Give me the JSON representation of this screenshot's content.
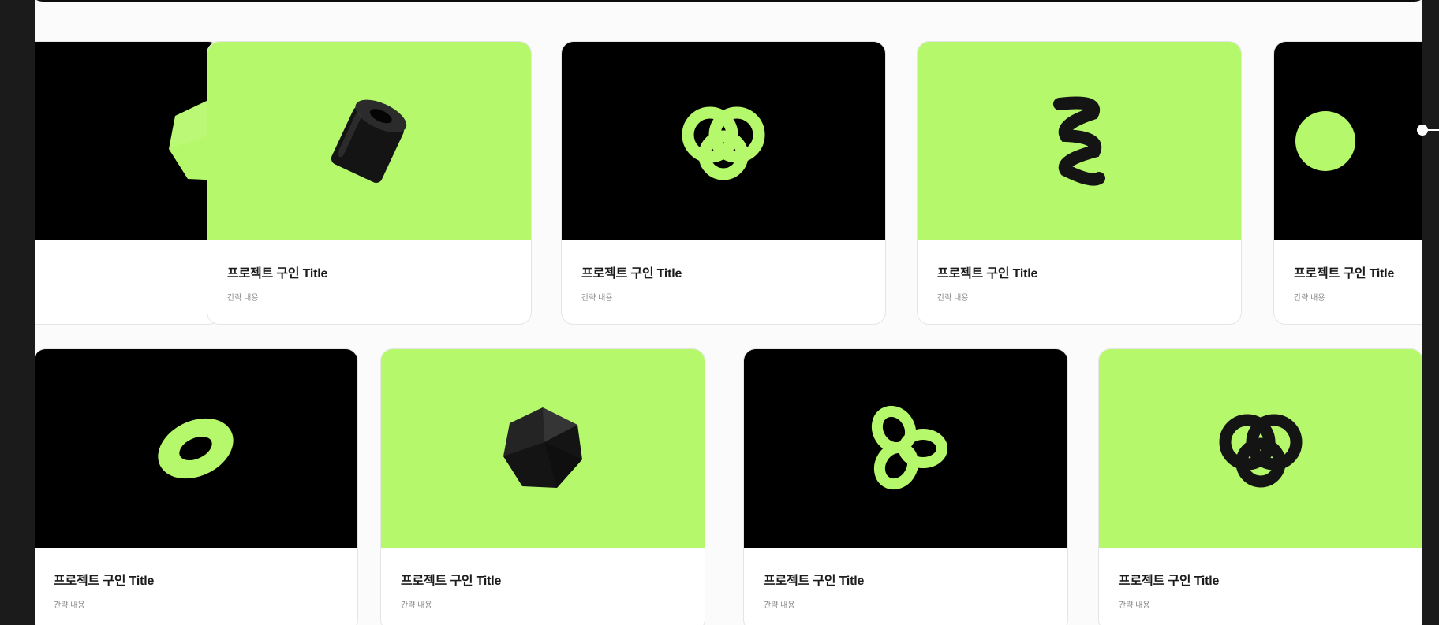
{
  "colors": {
    "accent_lime": "#b6f86b",
    "thumb_dark": "#000000",
    "page_background": "#fbfbfb",
    "outer_background": "#1b1b1b"
  },
  "rows": [
    {
      "cards": [
        {
          "title": "",
          "desc": "",
          "bg": "dark",
          "shape": "polyhedron-icon",
          "shape_color": "lime"
        },
        {
          "title": "프로젝트 구인 Title",
          "desc": "간략 내용",
          "bg": "lime",
          "shape": "cylinder-icon",
          "shape_color": "black"
        },
        {
          "title": "프로젝트 구인 Title",
          "desc": "간략 내용",
          "bg": "dark",
          "shape": "knot-icon",
          "shape_color": "lime"
        },
        {
          "title": "프로젝트 구인 Title",
          "desc": "간략 내용",
          "bg": "lime",
          "shape": "spiral-icon",
          "shape_color": "black"
        },
        {
          "title": "프로젝트 구인 Title",
          "desc": "간략 내용",
          "bg": "dark",
          "shape": "blob-icon",
          "shape_color": "lime"
        }
      ]
    },
    {
      "cards": [
        {
          "title": "프로젝트 구인 Title",
          "desc": "간략 내용",
          "bg": "dark",
          "shape": "torus-icon",
          "shape_color": "lime"
        },
        {
          "title": "프로젝트 구인 Title",
          "desc": "간략 내용",
          "bg": "lime",
          "shape": "polyhedron-icon",
          "shape_color": "black"
        },
        {
          "title": "프로젝트 구인 Title",
          "desc": "간략 내용",
          "bg": "dark",
          "shape": "trefoil-icon",
          "shape_color": "lime"
        },
        {
          "title": "프로젝트 구인 Title",
          "desc": "간략 내용",
          "bg": "lime",
          "shape": "knot-icon",
          "shape_color": "black"
        }
      ]
    }
  ]
}
